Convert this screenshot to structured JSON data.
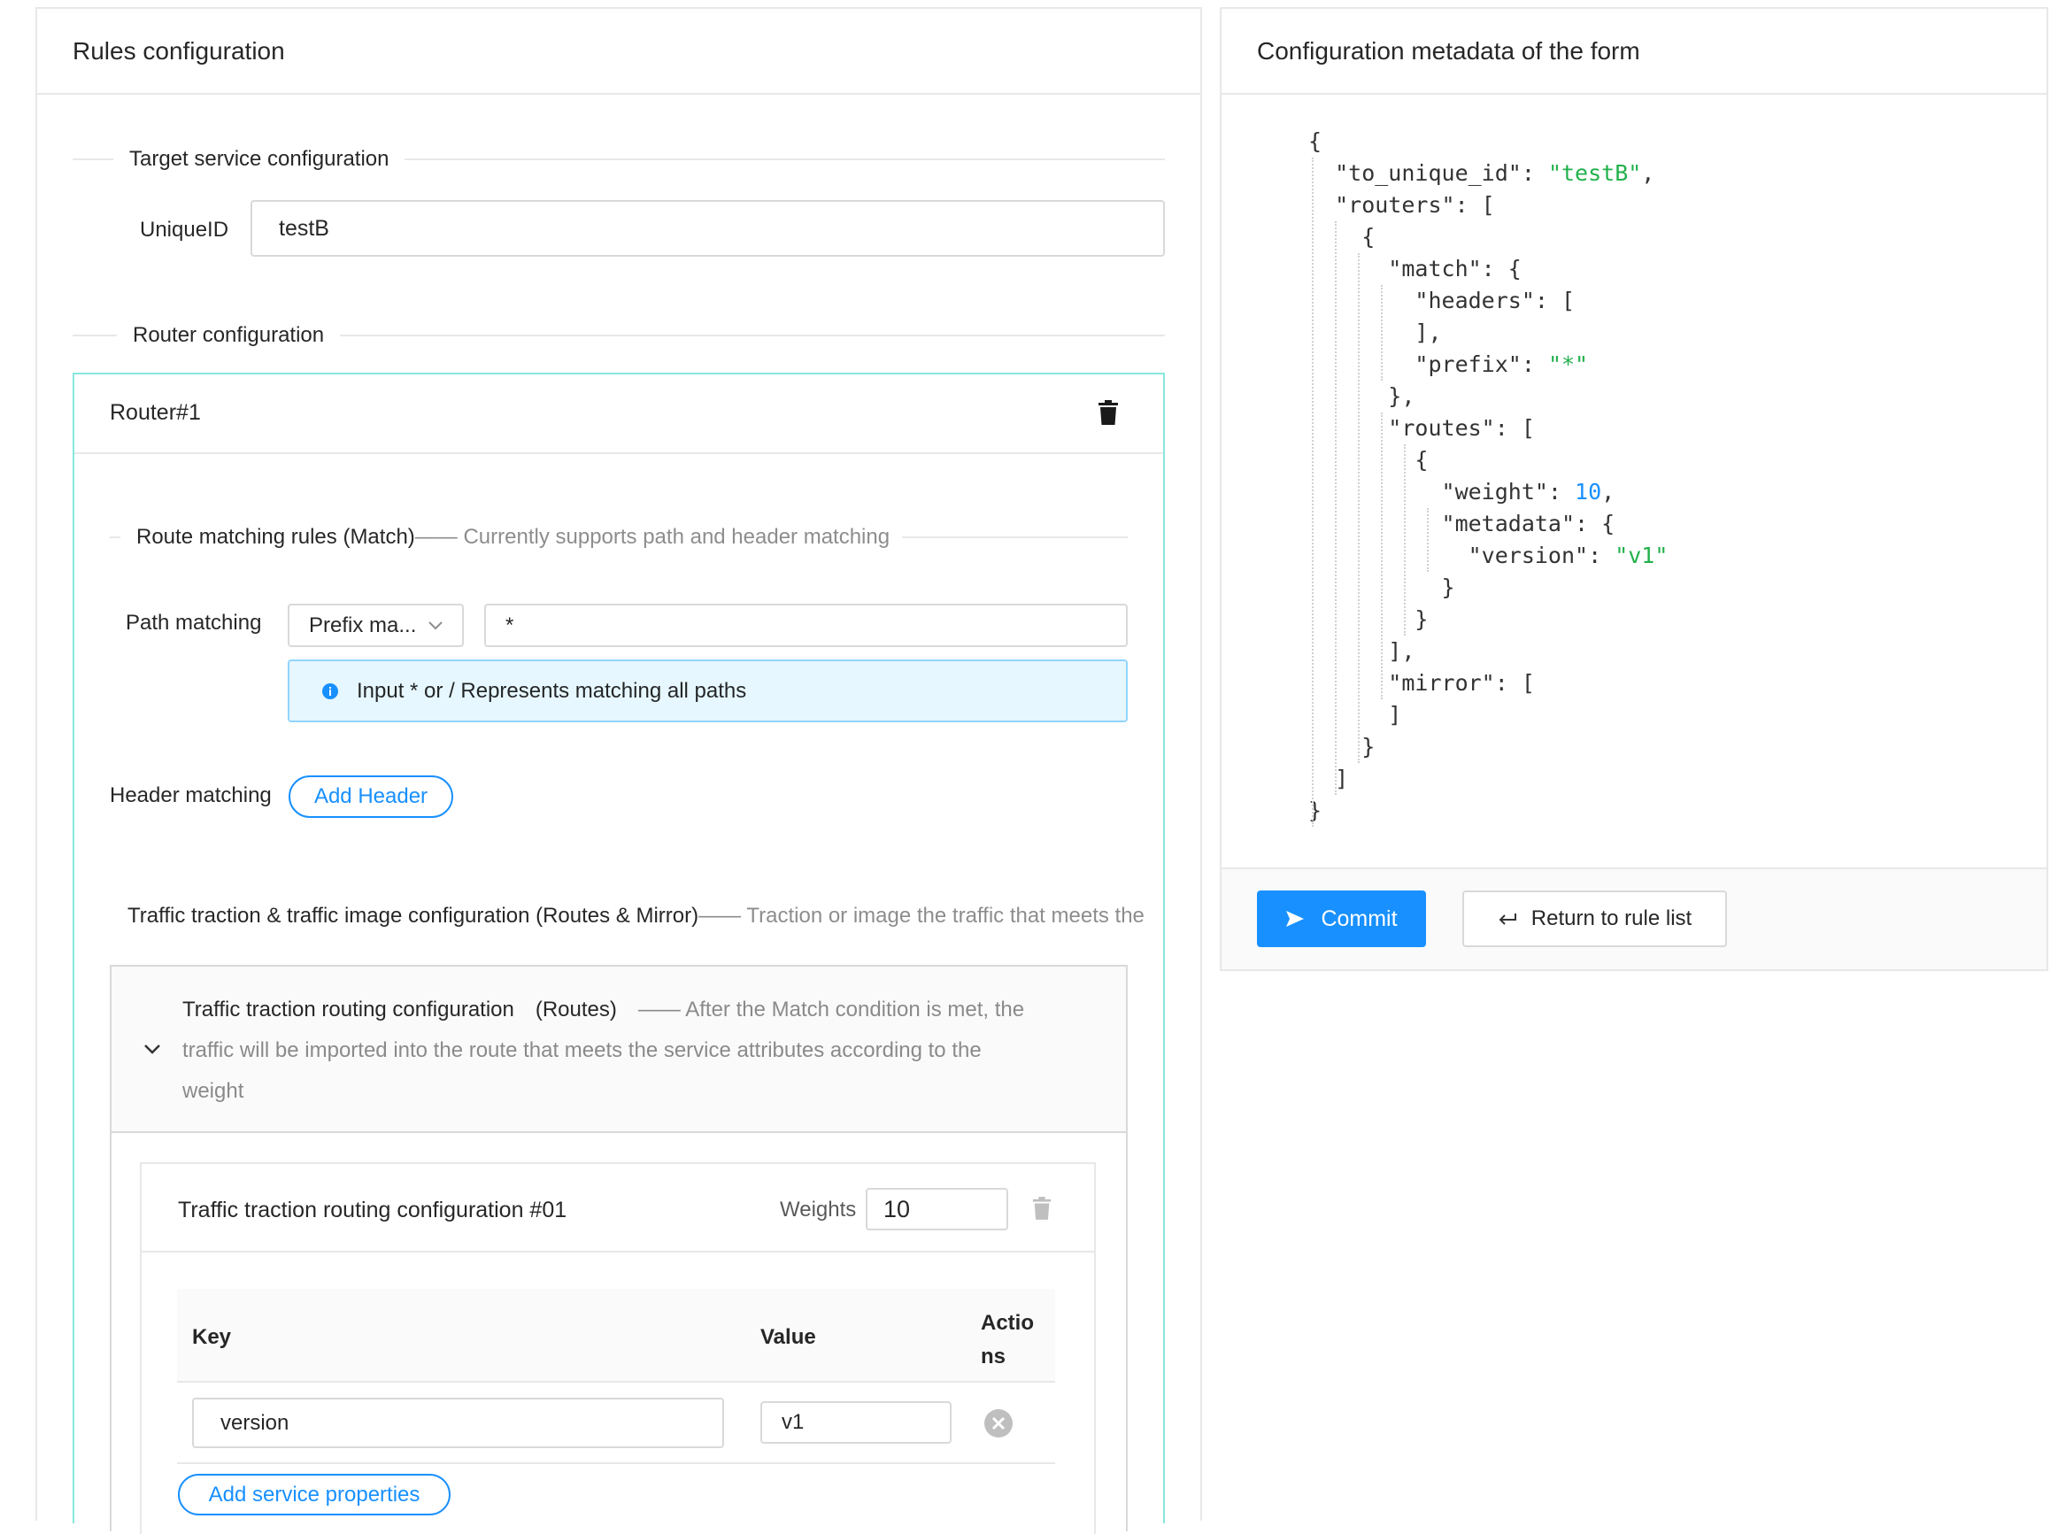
{
  "left_card": {
    "title": "Rules configuration",
    "target_section": "Target service configuration",
    "unique_id_label": "UniqueID",
    "unique_id_value": "testB",
    "router_section": "Router configuration",
    "router": {
      "title": "Router#1",
      "match_section_title": "Route matching rules (Match)",
      "match_section_desc": "—— Currently supports path and header matching",
      "path_label": "Path matching",
      "path_select_value": "Prefix ma...",
      "path_value": "*",
      "path_hint": "Input * or / Represents matching all paths",
      "header_label": "Header matching",
      "add_header": "Add Header",
      "traffic_section_title": "Traffic traction & traffic image configuration (Routes & Mirror)",
      "traffic_section_desc": "—— Traction or image the traffic that meets the",
      "routes_panel": {
        "title_line": "Traffic traction routing configuration　(Routes)",
        "desc_line1": "—— After the Match condition is met, the",
        "desc_line2": "traffic will be imported into the route that meets the service attributes according to the",
        "desc_line3": "weight",
        "route_title": "Traffic traction routing configuration #01",
        "weights_label": "Weights",
        "weights_value": "10",
        "table_headers": [
          "Key",
          "Value",
          "Actio",
          "ns"
        ],
        "rows": [
          {
            "key": "version",
            "value": "v1"
          }
        ],
        "add_properties": "Add service properties"
      }
    }
  },
  "right_card": {
    "title": "Configuration metadata of the form",
    "commit_label": "Commit",
    "return_label": "Return to rule list"
  },
  "json_preview": {
    "lines": [
      "{",
      "  \"to_unique_id\": ",
      "  \"routers\": [",
      "    {",
      "      \"match\": {",
      "        \"headers\": [",
      "        ],",
      "        \"prefix\": ",
      "      },",
      "      \"routes\": [",
      "        {",
      "          \"weight\": ",
      "          \"metadata\": {",
      "            \"version\": ",
      "          }",
      "        }",
      "      ],",
      "      \"mirror\": [",
      "      ]",
      "    }",
      "  ]",
      "}"
    ],
    "values": {
      "to_unique_id": "\"testB\"",
      "to_unique_id_tail": ",",
      "prefix": "\"*\"",
      "weight": "10",
      "weight_tail": ",",
      "version": "\"v1\""
    }
  },
  "colors": {
    "primary": "#1890ff",
    "border": "#e8e8e8",
    "router_border": "#87e8de",
    "info_bg": "#e6f7ff",
    "json_string": "#22b14c"
  },
  "icons": [
    "trash-icon",
    "chevron-down-icon",
    "info-icon",
    "close-circle-icon",
    "send-icon",
    "return-icon"
  ]
}
